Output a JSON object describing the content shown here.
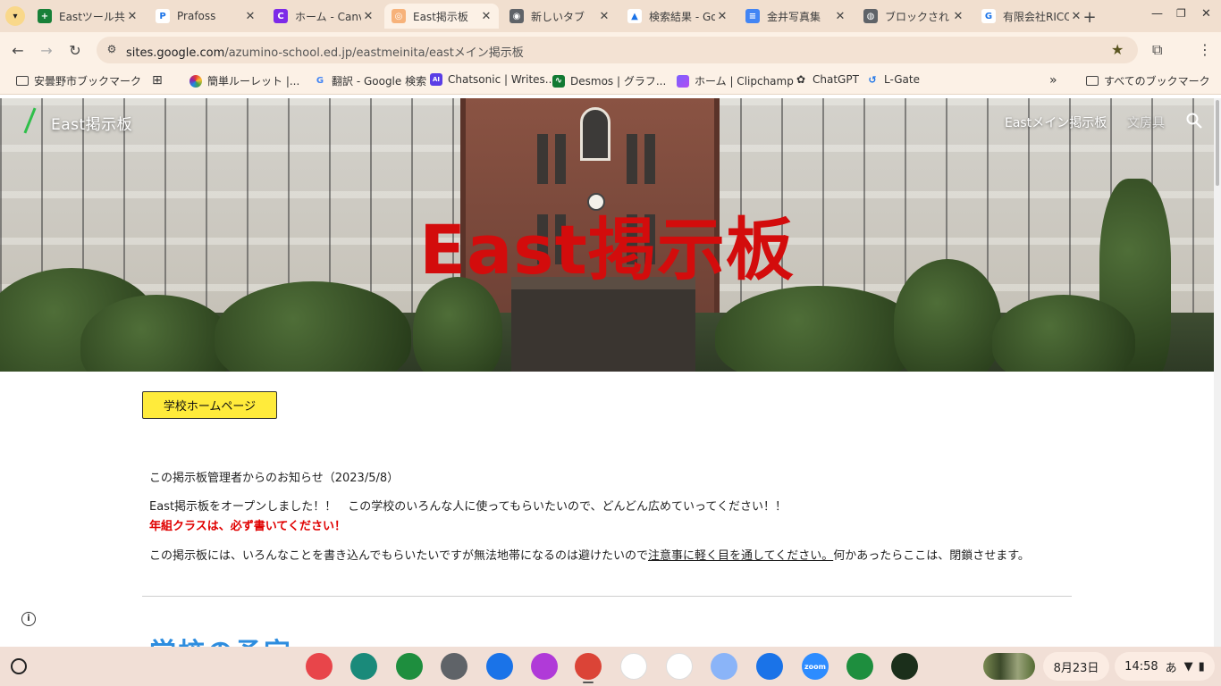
{
  "browser": {
    "tabs": [
      {
        "title": "Eastツール共",
        "fav_bg": "#188038",
        "fav_glyph": "+"
      },
      {
        "title": "Prafoss",
        "fav_bg": "#ffffff",
        "fav_glyph": "P"
      },
      {
        "title": "ホーム - Canva",
        "fav_bg": "#7d2ae8",
        "fav_glyph": "C"
      },
      {
        "title": "East掲示板",
        "fav_bg": "#f7b27a",
        "fav_glyph": "◎"
      },
      {
        "title": "新しいタブ",
        "fav_bg": "#5f6368",
        "fav_glyph": "◉"
      },
      {
        "title": "検索結果 - Google",
        "fav_bg": "#ffffff",
        "fav_glyph": "▲"
      },
      {
        "title": "金井写真集",
        "fav_bg": "#4285f4",
        "fav_glyph": "≡"
      },
      {
        "title": "ブロックされ",
        "fav_bg": "#5f6368",
        "fav_glyph": "◍"
      },
      {
        "title": "有限会社RICO",
        "fav_bg": "#ffffff",
        "fav_glyph": "G"
      }
    ],
    "active_tab": 3,
    "close_glyph": "✕",
    "new_tab": "+",
    "url_host": "sites.google.com",
    "url_path": "/azumino-school.ed.jp/eastmeinita/eastメイン掲示板"
  },
  "bookmarks": [
    {
      "label": "安曇野市ブックマーク",
      "icon": "folder-icon"
    },
    {
      "label": "",
      "icon": "apps-grid-icon"
    },
    {
      "label": "簡単ルーレット |...",
      "icon": "roulette-icon"
    },
    {
      "label": "翻訳 - Google 検索",
      "icon": "google-icon"
    },
    {
      "label": "Chatsonic | Writes...",
      "icon": "chatsonic-icon"
    },
    {
      "label": "Desmos | グラフ...",
      "icon": "desmos-icon"
    },
    {
      "label": "ホーム | Clipchamp",
      "icon": "clipchamp-icon"
    },
    {
      "label": "ChatGPT",
      "icon": "chatgpt-icon"
    },
    {
      "label": "L-Gate",
      "icon": "lgate-icon"
    }
  ],
  "bookmarks_overflow": "»",
  "all_bookmarks": "すべてのブックマーク",
  "site": {
    "title": "East掲示板",
    "nav": [
      "Eastメイン掲示板",
      "文房具"
    ],
    "hero_title": "East掲示板",
    "home_button": "学校ホームページ",
    "notice_heading": "この掲示板管理者からのお知らせ（2023/5/8）",
    "notice_line1": "East掲示板をオープンしました！！　この学校のいろんな人に使ってもらいたいので、どんどん広めていってください！！",
    "notice_red": "年組クラスは、必ず書いてください！",
    "notice_line3_a": "この掲示板には、いろんなことを書き込んでもらいたいですが無法地帯になるのは避けたいので",
    "notice_line3_link": "注意事に軽く目を通してください。",
    "notice_line3_b": "何かあったらここは、閉鎖させます。",
    "next_heading": "学校の予定"
  },
  "shelf": {
    "apps": [
      {
        "name": "canvas-app-icon",
        "bg": "#e8454a"
      },
      {
        "name": "classroom-screen-app-icon",
        "bg": "#1a8a7a"
      },
      {
        "name": "sheets-app-icon",
        "bg": "#1e8e3e"
      },
      {
        "name": "settings-app-icon",
        "bg": "#5f6368"
      },
      {
        "name": "files-app-icon",
        "bg": "#1a73e8"
      },
      {
        "name": "sparkle-app-icon",
        "bg": "#b03ad8"
      },
      {
        "name": "chrome-app-icon",
        "bg": "#db4437"
      },
      {
        "name": "gmail-app-icon",
        "bg": "#ffffff"
      },
      {
        "name": "drive-app-icon",
        "bg": "#ffffff"
      },
      {
        "name": "translate-app-icon",
        "bg": "#8ab4f8"
      },
      {
        "name": "camera-app-icon",
        "bg": "#1a73e8"
      },
      {
        "name": "zoom-app-icon",
        "bg": "#2d8cff"
      },
      {
        "name": "classroom-app-icon",
        "bg": "#1e8e3e"
      },
      {
        "name": "school-app-icon",
        "bg": "#1b2f1b"
      }
    ],
    "zoom_label": "zoom",
    "date": "8月23日",
    "time": "14:58",
    "ime": "あ"
  }
}
